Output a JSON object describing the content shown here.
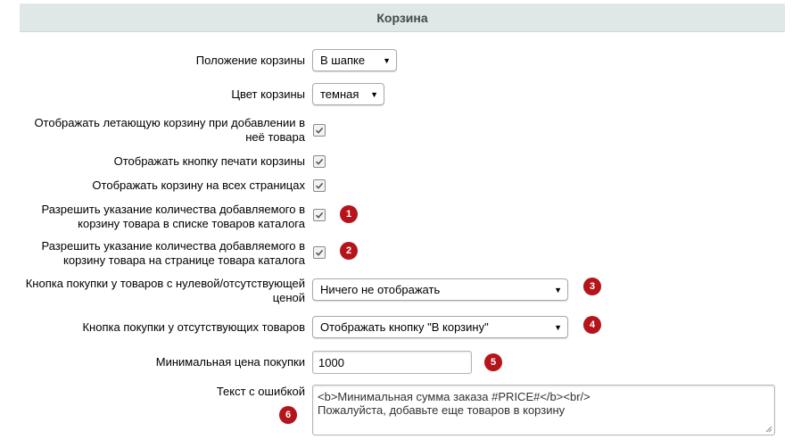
{
  "section": {
    "title": "Корзина"
  },
  "fields": {
    "basket_position": {
      "label": "Положение корзины",
      "value": "В шапке"
    },
    "basket_color": {
      "label": "Цвет корзины",
      "value": "темная"
    },
    "flying_basket": {
      "label_line1": "Отображать летающую корзину при добавлении в",
      "label_line2": "неё товара",
      "checked": true
    },
    "print_button": {
      "label": "Отображать кнопку печати корзины",
      "checked": true
    },
    "all_pages": {
      "label": "Отображать корзину на всех страницах",
      "checked": true
    },
    "qty_in_list": {
      "label_line1": "Разрешить указание количества добавляемого в",
      "label_line2": "корзину товара в списке товаров каталога",
      "checked": true,
      "badge": "1"
    },
    "qty_in_detail": {
      "label_line1": "Разрешить указание количества добавляемого в",
      "label_line2": "корзину товара на странице товара каталога",
      "checked": true,
      "badge": "2"
    },
    "zero_price_button": {
      "label_line1": "Кнопка покупки у товаров с нулевой/отсутствующей",
      "label_line2": "ценой",
      "value": "Ничего не отображать",
      "badge": "3"
    },
    "absent_button": {
      "label": "Кнопка покупки у отсутствующих товаров",
      "value": "Отображать кнопку \"В корзину\"",
      "badge": "4"
    },
    "min_price": {
      "label": "Минимальная цена покупки",
      "value": "1000",
      "badge": "5"
    },
    "error_text": {
      "label": "Текст с ошибкой",
      "line1": "<b>Минимальная сумма заказа #PRICE#</b><br/>",
      "line2": "Пожалуйста, добавьте еще товаров в корзину",
      "badge": "6"
    }
  }
}
